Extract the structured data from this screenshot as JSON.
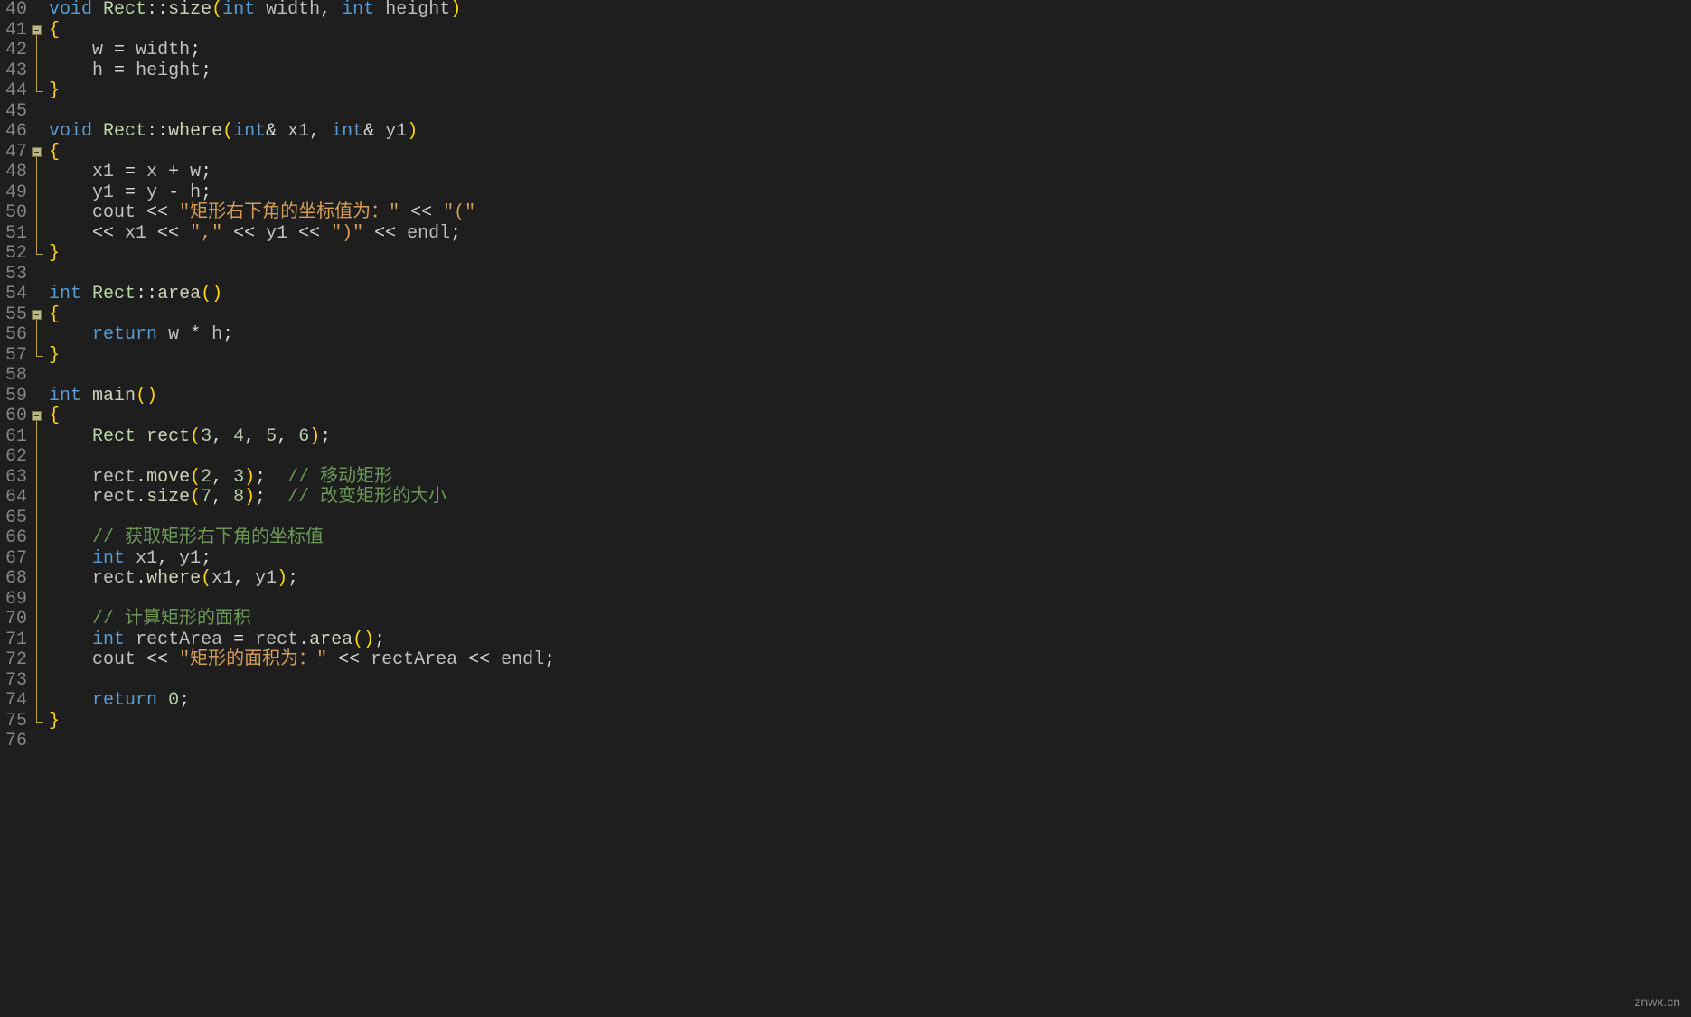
{
  "watermark": "znwx.cn",
  "startLine": 40,
  "endLine": 76,
  "foldMarkers": [
    41,
    47,
    55,
    60
  ],
  "foldRanges": [
    {
      "from": 41,
      "to": 44
    },
    {
      "from": 47,
      "to": 52
    },
    {
      "from": 55,
      "to": 57
    },
    {
      "from": 60,
      "to": 75
    }
  ],
  "lines": {
    "40": [
      {
        "c": "kw",
        "t": "void"
      },
      {
        "c": "punc",
        "t": " "
      },
      {
        "c": "cls",
        "t": "Rect"
      },
      {
        "c": "punc",
        "t": "::"
      },
      {
        "c": "fn",
        "t": "size"
      },
      {
        "c": "paren",
        "t": "("
      },
      {
        "c": "type",
        "t": "int"
      },
      {
        "c": "punc",
        "t": " "
      },
      {
        "c": "id",
        "t": "width"
      },
      {
        "c": "punc",
        "t": ", "
      },
      {
        "c": "type",
        "t": "int"
      },
      {
        "c": "punc",
        "t": " "
      },
      {
        "c": "id",
        "t": "height"
      },
      {
        "c": "paren",
        "t": ")"
      }
    ],
    "41": [
      {
        "c": "brace",
        "t": "{"
      }
    ],
    "42": [
      {
        "c": "punc",
        "t": "    "
      },
      {
        "c": "id",
        "t": "w"
      },
      {
        "c": "punc",
        "t": " = "
      },
      {
        "c": "id",
        "t": "width"
      },
      {
        "c": "punc",
        "t": ";"
      }
    ],
    "43": [
      {
        "c": "punc",
        "t": "    "
      },
      {
        "c": "id",
        "t": "h"
      },
      {
        "c": "punc",
        "t": " = "
      },
      {
        "c": "id",
        "t": "height"
      },
      {
        "c": "punc",
        "t": ";"
      }
    ],
    "44": [
      {
        "c": "brace",
        "t": "}"
      }
    ],
    "45": [],
    "46": [
      {
        "c": "kw",
        "t": "void"
      },
      {
        "c": "punc",
        "t": " "
      },
      {
        "c": "cls",
        "t": "Rect"
      },
      {
        "c": "punc",
        "t": "::"
      },
      {
        "c": "fn",
        "t": "where"
      },
      {
        "c": "paren",
        "t": "("
      },
      {
        "c": "type",
        "t": "int"
      },
      {
        "c": "punc",
        "t": "& "
      },
      {
        "c": "id",
        "t": "x1"
      },
      {
        "c": "punc",
        "t": ", "
      },
      {
        "c": "type",
        "t": "int"
      },
      {
        "c": "punc",
        "t": "& "
      },
      {
        "c": "id",
        "t": "y1"
      },
      {
        "c": "paren",
        "t": ")"
      }
    ],
    "47": [
      {
        "c": "brace",
        "t": "{"
      }
    ],
    "48": [
      {
        "c": "punc",
        "t": "    "
      },
      {
        "c": "id",
        "t": "x1"
      },
      {
        "c": "punc",
        "t": " = "
      },
      {
        "c": "id",
        "t": "x"
      },
      {
        "c": "punc",
        "t": " + "
      },
      {
        "c": "id",
        "t": "w"
      },
      {
        "c": "punc",
        "t": ";"
      }
    ],
    "49": [
      {
        "c": "punc",
        "t": "    "
      },
      {
        "c": "id",
        "t": "y1"
      },
      {
        "c": "punc",
        "t": " = "
      },
      {
        "c": "id",
        "t": "y"
      },
      {
        "c": "punc",
        "t": " - "
      },
      {
        "c": "id",
        "t": "h"
      },
      {
        "c": "punc",
        "t": ";"
      }
    ],
    "50": [
      {
        "c": "punc",
        "t": "    "
      },
      {
        "c": "id",
        "t": "cout"
      },
      {
        "c": "punc",
        "t": " << "
      },
      {
        "c": "str",
        "t": "\"矩形右下角的坐标值为：\""
      },
      {
        "c": "punc",
        "t": " << "
      },
      {
        "c": "str",
        "t": "\"(\""
      }
    ],
    "51": [
      {
        "c": "punc",
        "t": "    << "
      },
      {
        "c": "id",
        "t": "x1"
      },
      {
        "c": "punc",
        "t": " << "
      },
      {
        "c": "str",
        "t": "\",\""
      },
      {
        "c": "punc",
        "t": " << "
      },
      {
        "c": "id",
        "t": "y1"
      },
      {
        "c": "punc",
        "t": " << "
      },
      {
        "c": "str",
        "t": "\")\""
      },
      {
        "c": "punc",
        "t": " << "
      },
      {
        "c": "id",
        "t": "endl"
      },
      {
        "c": "punc",
        "t": ";"
      }
    ],
    "52": [
      {
        "c": "brace",
        "t": "}"
      }
    ],
    "53": [],
    "54": [
      {
        "c": "type",
        "t": "int"
      },
      {
        "c": "punc",
        "t": " "
      },
      {
        "c": "cls",
        "t": "Rect"
      },
      {
        "c": "punc",
        "t": "::"
      },
      {
        "c": "fn",
        "t": "area"
      },
      {
        "c": "paren",
        "t": "()"
      }
    ],
    "55": [
      {
        "c": "brace",
        "t": "{"
      }
    ],
    "56": [
      {
        "c": "punc",
        "t": "    "
      },
      {
        "c": "kw",
        "t": "return"
      },
      {
        "c": "punc",
        "t": " "
      },
      {
        "c": "id",
        "t": "w"
      },
      {
        "c": "punc",
        "t": " * "
      },
      {
        "c": "id",
        "t": "h"
      },
      {
        "c": "punc",
        "t": ";"
      }
    ],
    "57": [
      {
        "c": "brace",
        "t": "}"
      }
    ],
    "58": [],
    "59": [
      {
        "c": "type",
        "t": "int"
      },
      {
        "c": "punc",
        "t": " "
      },
      {
        "c": "fn",
        "t": "main"
      },
      {
        "c": "paren",
        "t": "()"
      }
    ],
    "60": [
      {
        "c": "brace",
        "t": "{"
      }
    ],
    "61": [
      {
        "c": "punc",
        "t": "    "
      },
      {
        "c": "cls",
        "t": "Rect"
      },
      {
        "c": "punc",
        "t": " "
      },
      {
        "c": "fn",
        "t": "rect"
      },
      {
        "c": "paren",
        "t": "("
      },
      {
        "c": "num",
        "t": "3"
      },
      {
        "c": "punc",
        "t": ", "
      },
      {
        "c": "num",
        "t": "4"
      },
      {
        "c": "punc",
        "t": ", "
      },
      {
        "c": "num",
        "t": "5"
      },
      {
        "c": "punc",
        "t": ", "
      },
      {
        "c": "num",
        "t": "6"
      },
      {
        "c": "paren",
        "t": ")"
      },
      {
        "c": "punc",
        "t": ";"
      }
    ],
    "62": [],
    "63": [
      {
        "c": "punc",
        "t": "    "
      },
      {
        "c": "id",
        "t": "rect"
      },
      {
        "c": "punc",
        "t": "."
      },
      {
        "c": "fn",
        "t": "move"
      },
      {
        "c": "paren",
        "t": "("
      },
      {
        "c": "num",
        "t": "2"
      },
      {
        "c": "punc",
        "t": ", "
      },
      {
        "c": "num",
        "t": "3"
      },
      {
        "c": "paren",
        "t": ")"
      },
      {
        "c": "punc",
        "t": ";  "
      },
      {
        "c": "cmt",
        "t": "// 移动矩形"
      }
    ],
    "64": [
      {
        "c": "punc",
        "t": "    "
      },
      {
        "c": "id",
        "t": "rect"
      },
      {
        "c": "punc",
        "t": "."
      },
      {
        "c": "fn",
        "t": "size"
      },
      {
        "c": "paren",
        "t": "("
      },
      {
        "c": "num",
        "t": "7"
      },
      {
        "c": "punc",
        "t": ", "
      },
      {
        "c": "num",
        "t": "8"
      },
      {
        "c": "paren",
        "t": ")"
      },
      {
        "c": "punc",
        "t": ";  "
      },
      {
        "c": "cmt",
        "t": "// 改变矩形的大小"
      }
    ],
    "65": [],
    "66": [
      {
        "c": "punc",
        "t": "    "
      },
      {
        "c": "cmt",
        "t": "// 获取矩形右下角的坐标值"
      }
    ],
    "67": [
      {
        "c": "punc",
        "t": "    "
      },
      {
        "c": "type",
        "t": "int"
      },
      {
        "c": "punc",
        "t": " "
      },
      {
        "c": "id",
        "t": "x1"
      },
      {
        "c": "punc",
        "t": ", "
      },
      {
        "c": "id",
        "t": "y1"
      },
      {
        "c": "punc",
        "t": ";"
      }
    ],
    "68": [
      {
        "c": "punc",
        "t": "    "
      },
      {
        "c": "id",
        "t": "rect"
      },
      {
        "c": "punc",
        "t": "."
      },
      {
        "c": "fn",
        "t": "where"
      },
      {
        "c": "paren",
        "t": "("
      },
      {
        "c": "id",
        "t": "x1"
      },
      {
        "c": "punc",
        "t": ", "
      },
      {
        "c": "id",
        "t": "y1"
      },
      {
        "c": "paren",
        "t": ")"
      },
      {
        "c": "punc",
        "t": ";"
      }
    ],
    "69": [],
    "70": [
      {
        "c": "punc",
        "t": "    "
      },
      {
        "c": "cmt",
        "t": "// 计算矩形的面积"
      }
    ],
    "71": [
      {
        "c": "punc",
        "t": "    "
      },
      {
        "c": "type",
        "t": "int"
      },
      {
        "c": "punc",
        "t": " "
      },
      {
        "c": "id",
        "t": "rectArea"
      },
      {
        "c": "punc",
        "t": " = "
      },
      {
        "c": "id",
        "t": "rect"
      },
      {
        "c": "punc",
        "t": "."
      },
      {
        "c": "fn",
        "t": "area"
      },
      {
        "c": "paren",
        "t": "()"
      },
      {
        "c": "punc",
        "t": ";"
      }
    ],
    "72": [
      {
        "c": "punc",
        "t": "    "
      },
      {
        "c": "id",
        "t": "cout"
      },
      {
        "c": "punc",
        "t": " << "
      },
      {
        "c": "str",
        "t": "\"矩形的面积为：\""
      },
      {
        "c": "punc",
        "t": " << "
      },
      {
        "c": "id",
        "t": "rectArea"
      },
      {
        "c": "punc",
        "t": " << "
      },
      {
        "c": "id",
        "t": "endl"
      },
      {
        "c": "punc",
        "t": ";"
      }
    ],
    "73": [],
    "74": [
      {
        "c": "punc",
        "t": "    "
      },
      {
        "c": "kw",
        "t": "return"
      },
      {
        "c": "punc",
        "t": " "
      },
      {
        "c": "num",
        "t": "0"
      },
      {
        "c": "punc",
        "t": ";"
      }
    ],
    "75": [
      {
        "c": "brace",
        "t": "}"
      }
    ],
    "76": []
  }
}
